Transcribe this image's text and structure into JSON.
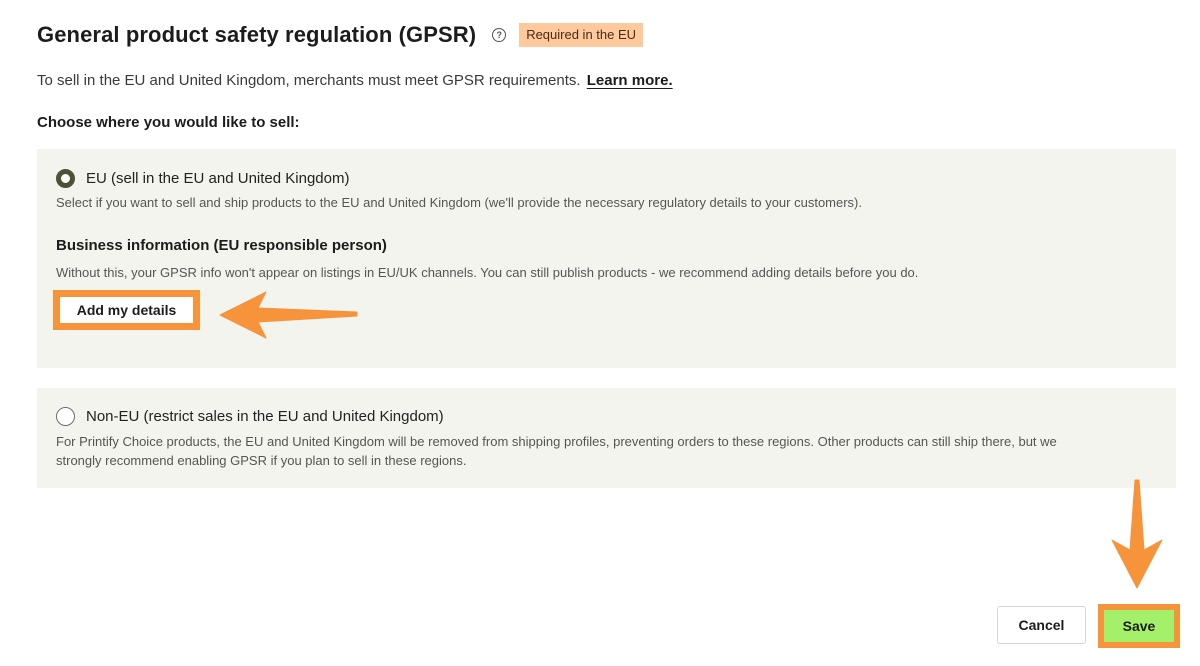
{
  "header": {
    "title": "General product safety regulation (GPSR)",
    "help_icon": "?",
    "badge": "Required in the EU"
  },
  "intro": {
    "text": "To sell in the EU and United Kingdom, merchants must meet GPSR requirements.",
    "link": "Learn more."
  },
  "choose_label": "Choose where you would like to sell:",
  "options": {
    "eu": {
      "label": "EU (sell in the EU and United Kingdom)",
      "description": "Select if you want to sell and ship products to the EU and United Kingdom (we'll provide the necessary regulatory details to your customers).",
      "selected": true,
      "business_title": "Business information (EU responsible person)",
      "business_desc": "Without this, your GPSR info won't appear on listings in EU/UK channels. You can still publish products - we recommend adding details before you do.",
      "add_button": "Add my details"
    },
    "non_eu": {
      "label": "Non-EU (restrict sales in the EU and United Kingdom)",
      "description_line1": "For Printify Choice products, the EU and United Kingdom will be removed from shipping profiles, preventing orders to these regions. Other products can still ship there, but we",
      "description_line2": "strongly recommend enabling GPSR if you plan to sell in these regions.",
      "selected": false
    }
  },
  "footer": {
    "cancel": "Cancel",
    "save": "Save"
  },
  "colors": {
    "annotation": "#f6933b",
    "badge_bg": "#fdc99d",
    "save_bg": "#a5f06a",
    "card_bg": "#f4f4ef"
  },
  "icons": {
    "help": "help-circle-icon",
    "annotation_left": "arrow-left-icon",
    "annotation_down": "arrow-down-icon"
  }
}
